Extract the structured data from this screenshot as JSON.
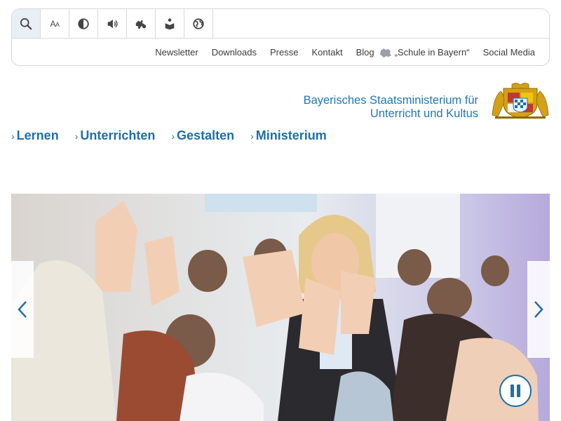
{
  "toolbar": {
    "tools": [
      {
        "icon": "search-icon"
      },
      {
        "icon": "font-size-icon",
        "label_big": "A",
        "label_small": "A"
      },
      {
        "icon": "contrast-icon"
      },
      {
        "icon": "speaker-icon"
      },
      {
        "icon": "sign-language-icon"
      },
      {
        "icon": "easy-reading-icon"
      },
      {
        "icon": "language-globe-icon"
      }
    ]
  },
  "metanav": {
    "newsletter": "Newsletter",
    "downloads": "Downloads",
    "presse": "Presse",
    "kontakt": "Kontakt",
    "blog": "Blog",
    "blog_name": "„Schule in Bayern“",
    "social": "Social Media"
  },
  "brand": {
    "line1": "Bayerisches Staatsministerium für",
    "line2": "Unterricht und Kultus"
  },
  "mainnav": {
    "items": [
      "Lernen",
      "Unterrichten",
      "Gestalten",
      "Ministerium"
    ]
  },
  "colors": {
    "accent": "#1f6fa8",
    "brand_text": "#1f78b4"
  }
}
